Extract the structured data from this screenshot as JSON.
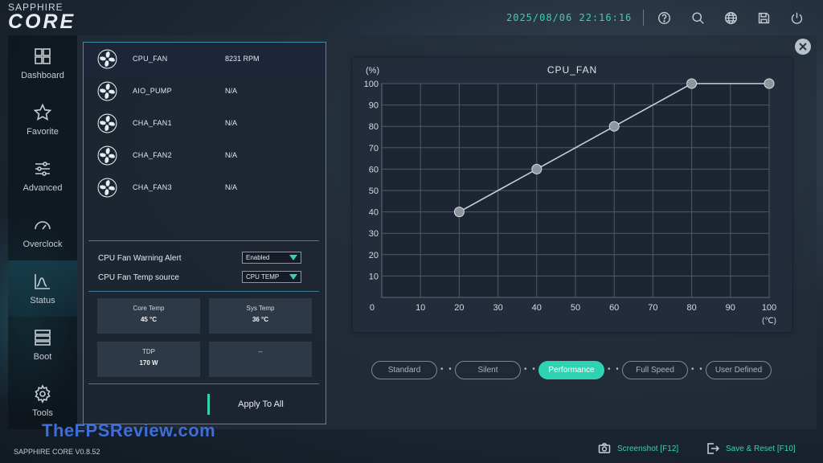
{
  "brand": {
    "top": "SAPPHIRE",
    "main": "CORE"
  },
  "datetime": "2025/08/06 22:16:16",
  "top_icons": [
    "help-icon",
    "search-icon",
    "globe-icon",
    "save-icon",
    "power-icon"
  ],
  "sidebar": {
    "items": [
      {
        "label": "Dashboard",
        "icon": "dashboard-icon"
      },
      {
        "label": "Favorite",
        "icon": "star-icon"
      },
      {
        "label": "Advanced",
        "icon": "sliders-icon"
      },
      {
        "label": "Overclock",
        "icon": "gauge-icon"
      },
      {
        "label": "Status",
        "icon": "chart-icon",
        "active": true
      },
      {
        "label": "Boot",
        "icon": "boot-icon"
      },
      {
        "label": "Tools",
        "icon": "gear-icon"
      }
    ]
  },
  "fans": [
    {
      "name": "CPU_FAN",
      "value": "8231 RPM",
      "active": true
    },
    {
      "name": "AIO_PUMP",
      "value": "N/A"
    },
    {
      "name": "CHA_FAN1",
      "value": "N/A"
    },
    {
      "name": "CHA_FAN2",
      "value": "N/A"
    },
    {
      "name": "CHA_FAN3",
      "value": "N/A"
    }
  ],
  "settings": {
    "warning_label": "CPU Fan Warning Alert",
    "warning_value": "Enabled",
    "source_label": "CPU Fan Temp source",
    "source_value": "CPU TEMP"
  },
  "cards": [
    {
      "label": "Core Temp",
      "value": "45 °C"
    },
    {
      "label": "Sys Temp",
      "value": "36 °C"
    },
    {
      "label": "TDP",
      "value": "170 W"
    },
    {
      "label": "--",
      "value": ""
    }
  ],
  "apply_label": "Apply To All",
  "chart_data": {
    "type": "line",
    "title": "CPU_FAN",
    "ylabel": "(%)",
    "xlabel": "(℃)",
    "xlim": [
      0,
      100
    ],
    "ylim": [
      0,
      100
    ],
    "xticks": [
      10,
      20,
      30,
      40,
      50,
      60,
      70,
      80,
      90,
      100
    ],
    "yticks": [
      10,
      20,
      30,
      40,
      50,
      60,
      70,
      80,
      90,
      100
    ],
    "origin_label": "0",
    "grid": true,
    "series": [
      {
        "x": [
          20,
          40,
          60,
          80,
          100
        ],
        "y": [
          40,
          60,
          80,
          100,
          100
        ]
      }
    ]
  },
  "modes": [
    {
      "label": "Standard"
    },
    {
      "label": "Silent"
    },
    {
      "label": "Performance",
      "active": true
    },
    {
      "label": "Full Speed"
    },
    {
      "label": "User Defined"
    }
  ],
  "mode_sep": "• •",
  "footer": {
    "version": "SAPPHIRE CORE V0.8.52",
    "watermark": "TheFPSReview.com",
    "screenshot": "Screenshot [F12]",
    "save_reset": "Save & Reset [F10]"
  }
}
